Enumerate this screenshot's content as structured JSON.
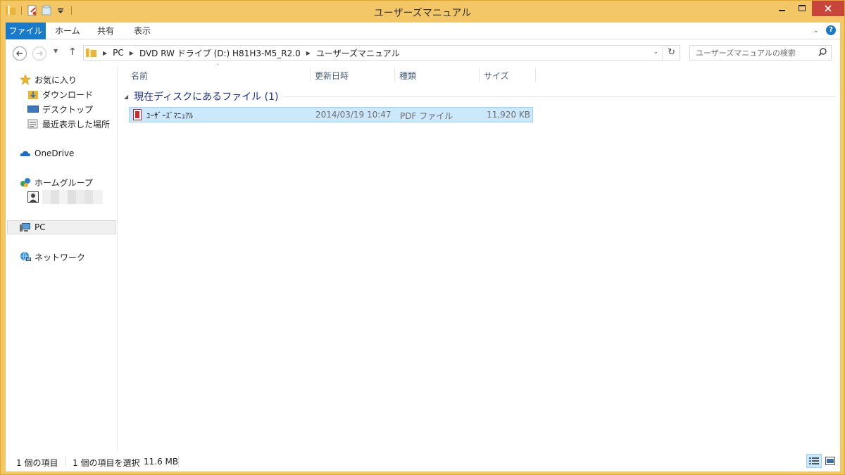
{
  "window": {
    "title": "ユーザーズマニュアル"
  },
  "ribbon": {
    "tabs": [
      "ファイル",
      "ホーム",
      "共有",
      "表示"
    ],
    "help_label": "?"
  },
  "navigation": {
    "address": {
      "crumbs": [
        "PC",
        "DVD RW ドライブ (D:) H81H3-M5_R2.0",
        "ユーザーズマニュアル"
      ]
    },
    "search_placeholder": "ユーザーズマニュアルの検索"
  },
  "nav_pane": {
    "favorites_label": "お気に入り",
    "favorites": [
      "ダウンロード",
      "デスクトップ",
      "最近表示した場所"
    ],
    "onedrive_label": "OneDrive",
    "homegroup_label": "ホームグループ",
    "pc_label": "PC",
    "network_label": "ネットワーク"
  },
  "columns": [
    "名前",
    "更新日時",
    "種類",
    "サイズ"
  ],
  "group": {
    "title": "現在ディスクにあるファイル (1)"
  },
  "files": [
    {
      "name": "ﾕｰｻﾞｰｽﾞﾏﾆｭｱﾙ",
      "modified": "2014/03/19 10:47",
      "type": "PDF ファイル",
      "size": "11,920 KB"
    }
  ],
  "status": {
    "count": "1 個の項目",
    "selection": "1 個の項目を選択",
    "size": "11.6 MB"
  },
  "colors": {
    "title_bar": "#f4c766",
    "accent": "#1979ca",
    "selection": "#cce8ff"
  }
}
